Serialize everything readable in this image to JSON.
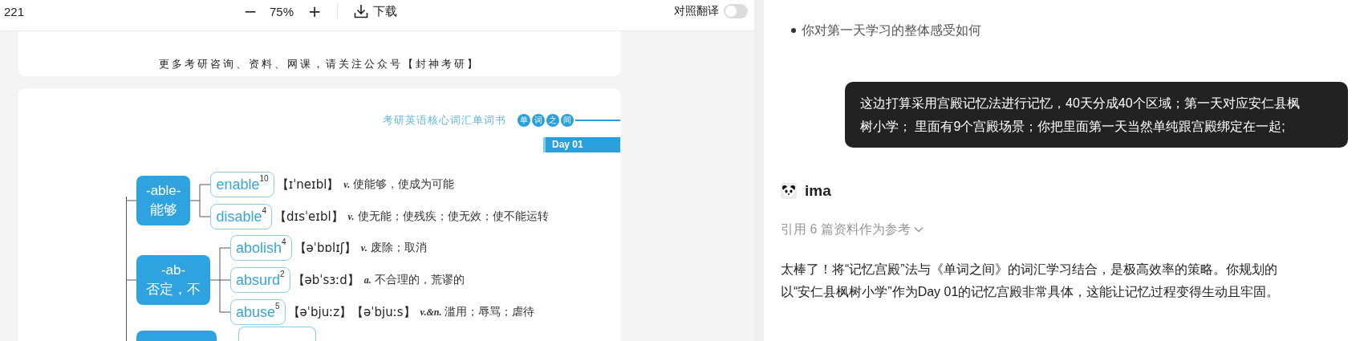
{
  "toolbar": {
    "page_number": "221",
    "zoom_out": "−",
    "zoom": "75%",
    "zoom_in": "+",
    "download": "下载",
    "compare_label": "对照翻译",
    "compare_on": false
  },
  "document": {
    "footer": "更多考研咨询、资料、网课，请关注公众号【封神考研】",
    "header": "考研英语核心词汇单词书",
    "badge_chars": [
      "单",
      "词",
      "之",
      "间"
    ],
    "day": "Day 01",
    "groups": [
      {
        "affix": "-able-",
        "meaning": "能够",
        "words": [
          {
            "word": "enable",
            "freq": "10",
            "phonetic": "【ɪˈneɪbl】",
            "pos": "v.",
            "definition": "使能够，使成为可能"
          },
          {
            "word": "disable",
            "freq": "4",
            "phonetic": "【dɪsˈeɪbl】",
            "pos": "v.",
            "definition": "使无能；使残疾；使无效；使不能运转"
          }
        ]
      },
      {
        "affix": "-ab-",
        "meaning": "否定，不",
        "words": [
          {
            "word": "abolish",
            "freq": "4",
            "phonetic": "【əˈbɒlɪʃ】",
            "pos": "v.",
            "definition": "废除；取消"
          },
          {
            "word": "absurd",
            "freq": "2",
            "phonetic": "【əbˈsɜːd】",
            "pos": "a.",
            "definition": "不合理的，荒谬的"
          },
          {
            "word": "abuse",
            "freq": "5",
            "phonetic": "【əˈbjuːz】【əˈbjuːs】",
            "pos": "v.&n.",
            "definition": "滥用；辱骂；虐待"
          }
        ]
      }
    ]
  },
  "chat": {
    "bullets": [
      "你对第一天学习的整体感受如何"
    ],
    "user_message": "这边打算采用宫殿记忆法进行记忆，40天分成40个区域；第一天对应安仁县枫树小学； 里面有9个宫殿场景；你把里面第一天当然单纯跟宫殿绑定在一起;",
    "assistant": {
      "name": "ima",
      "references": "引用 6 篇资料作为参考",
      "reply": "太棒了！将“记忆宫殿”法与《单词之间》的词汇学习结合，是极高效率的策略。你规划的以“安仁县枫树小学”作为Day 01的记忆宫殿非常具体，这能让记忆过程变得生动且牢固。"
    }
  }
}
